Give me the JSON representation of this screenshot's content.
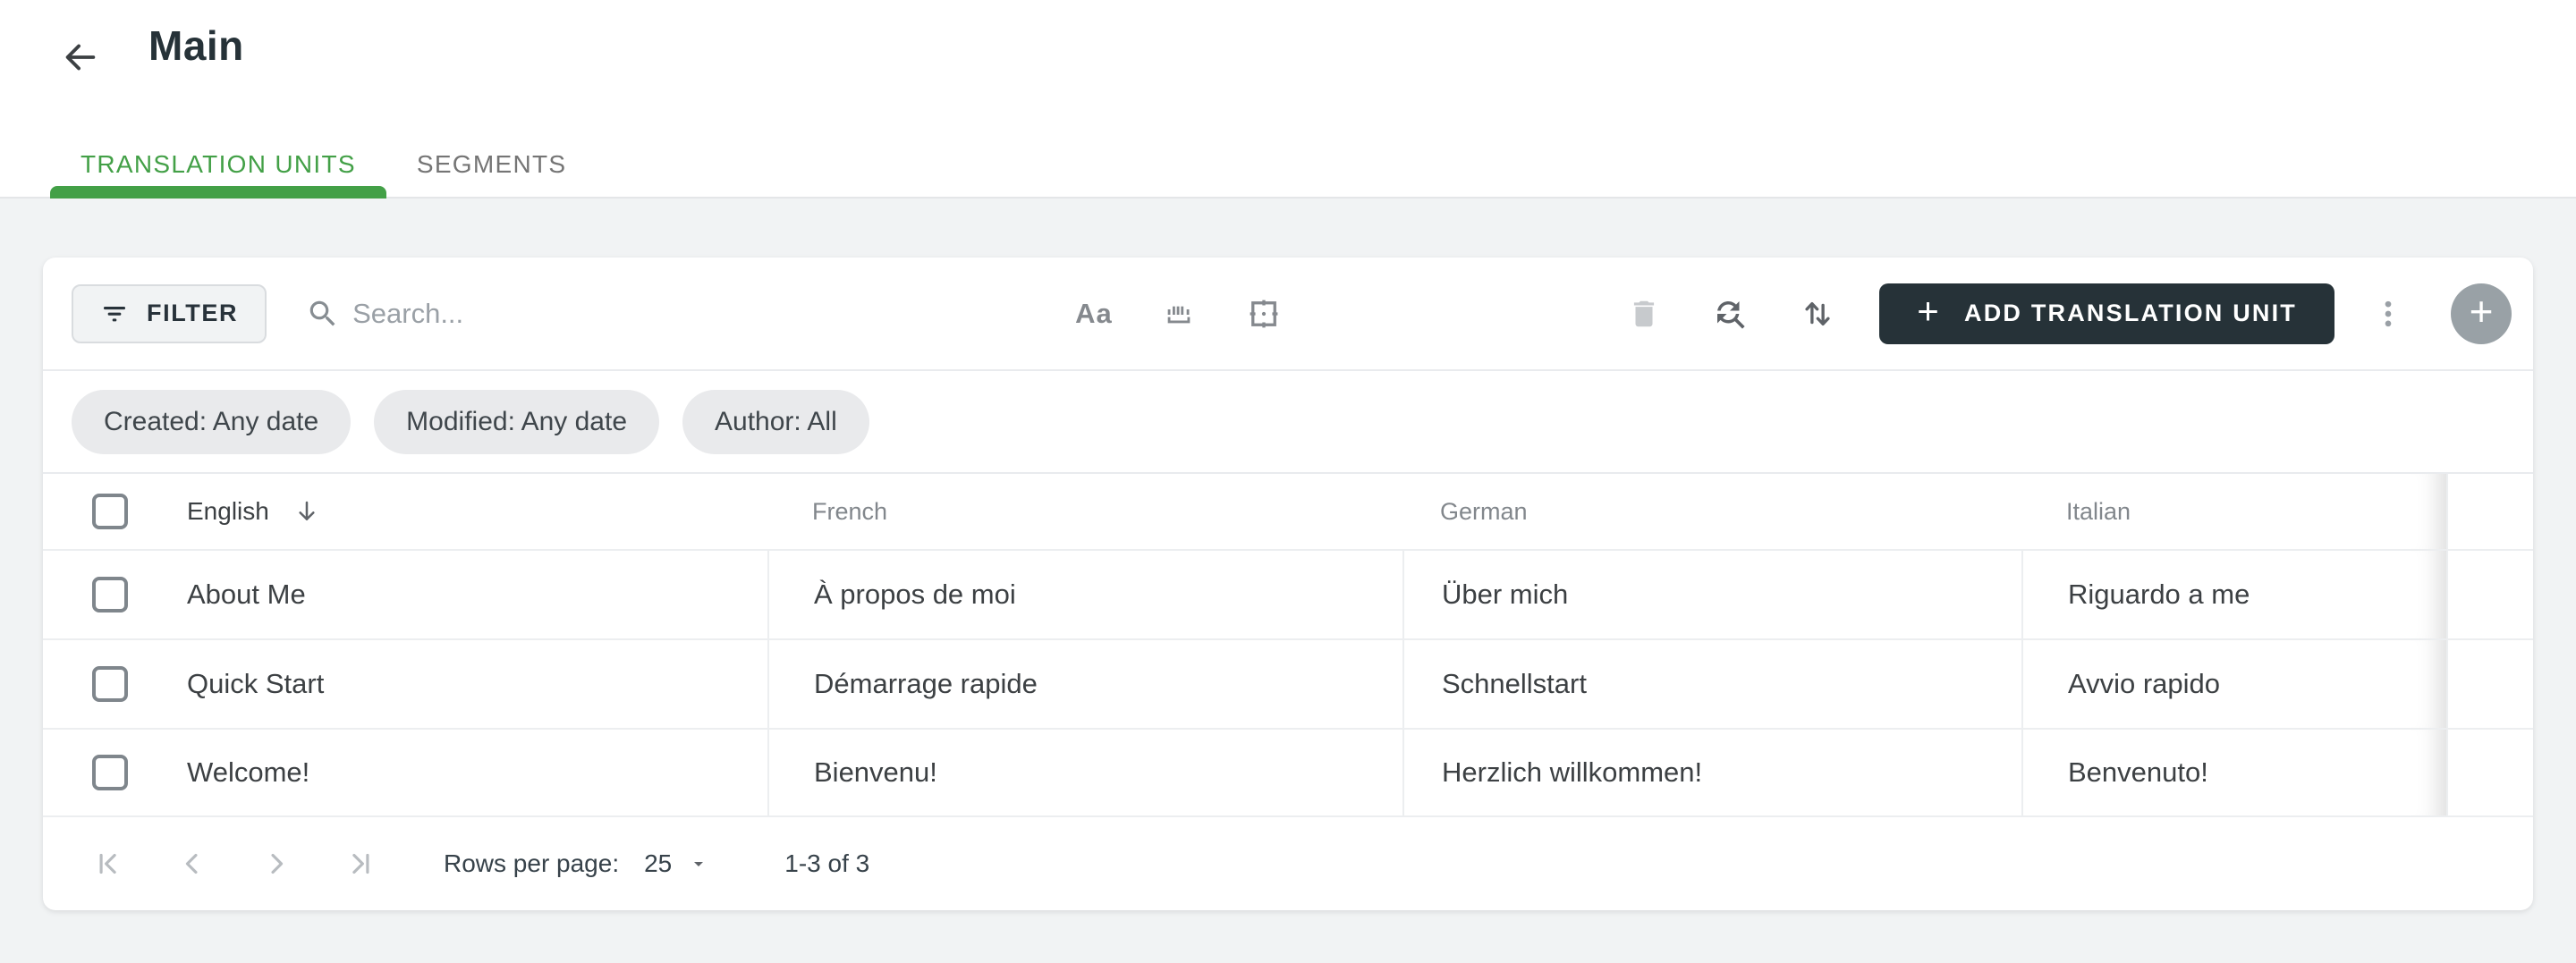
{
  "page": {
    "title": "Main",
    "tabs": [
      {
        "label": "TRANSLATION UNITS",
        "active": true
      },
      {
        "label": "SEGMENTS",
        "active": false
      }
    ]
  },
  "toolbar": {
    "filter_label": "FILTER",
    "search_placeholder": "Search...",
    "match_case_label": "Aa",
    "add_button_label": "ADD TRANSLATION UNIT"
  },
  "filters": {
    "chips": [
      "Created: Any date",
      "Modified: Any date",
      "Author: All"
    ]
  },
  "table": {
    "columns": [
      "English",
      "French",
      "German",
      "Italian"
    ],
    "sort_column": "English",
    "sort_icon": "arrow-down",
    "rows": [
      [
        "About Me",
        "À propos de moi",
        "Über mich",
        "Riguardo a me"
      ],
      [
        "Quick Start",
        "Démarrage rapide",
        "Schnellstart",
        "Avvio rapido"
      ],
      [
        "Welcome!",
        "Bienvenu!",
        "Herzlich willkommen!",
        "Benvenuto!"
      ]
    ]
  },
  "pagination": {
    "rows_per_page_label": "Rows per page:",
    "rows_per_page": "25",
    "range_label": "1-3 of 3"
  },
  "theme": {
    "accent_green": "#43a047",
    "dark_button": "#263238",
    "page_background": "#f1f3f4",
    "border": "#e9ebee",
    "text_primary": "#3c4043",
    "text_secondary": "#82878c"
  }
}
